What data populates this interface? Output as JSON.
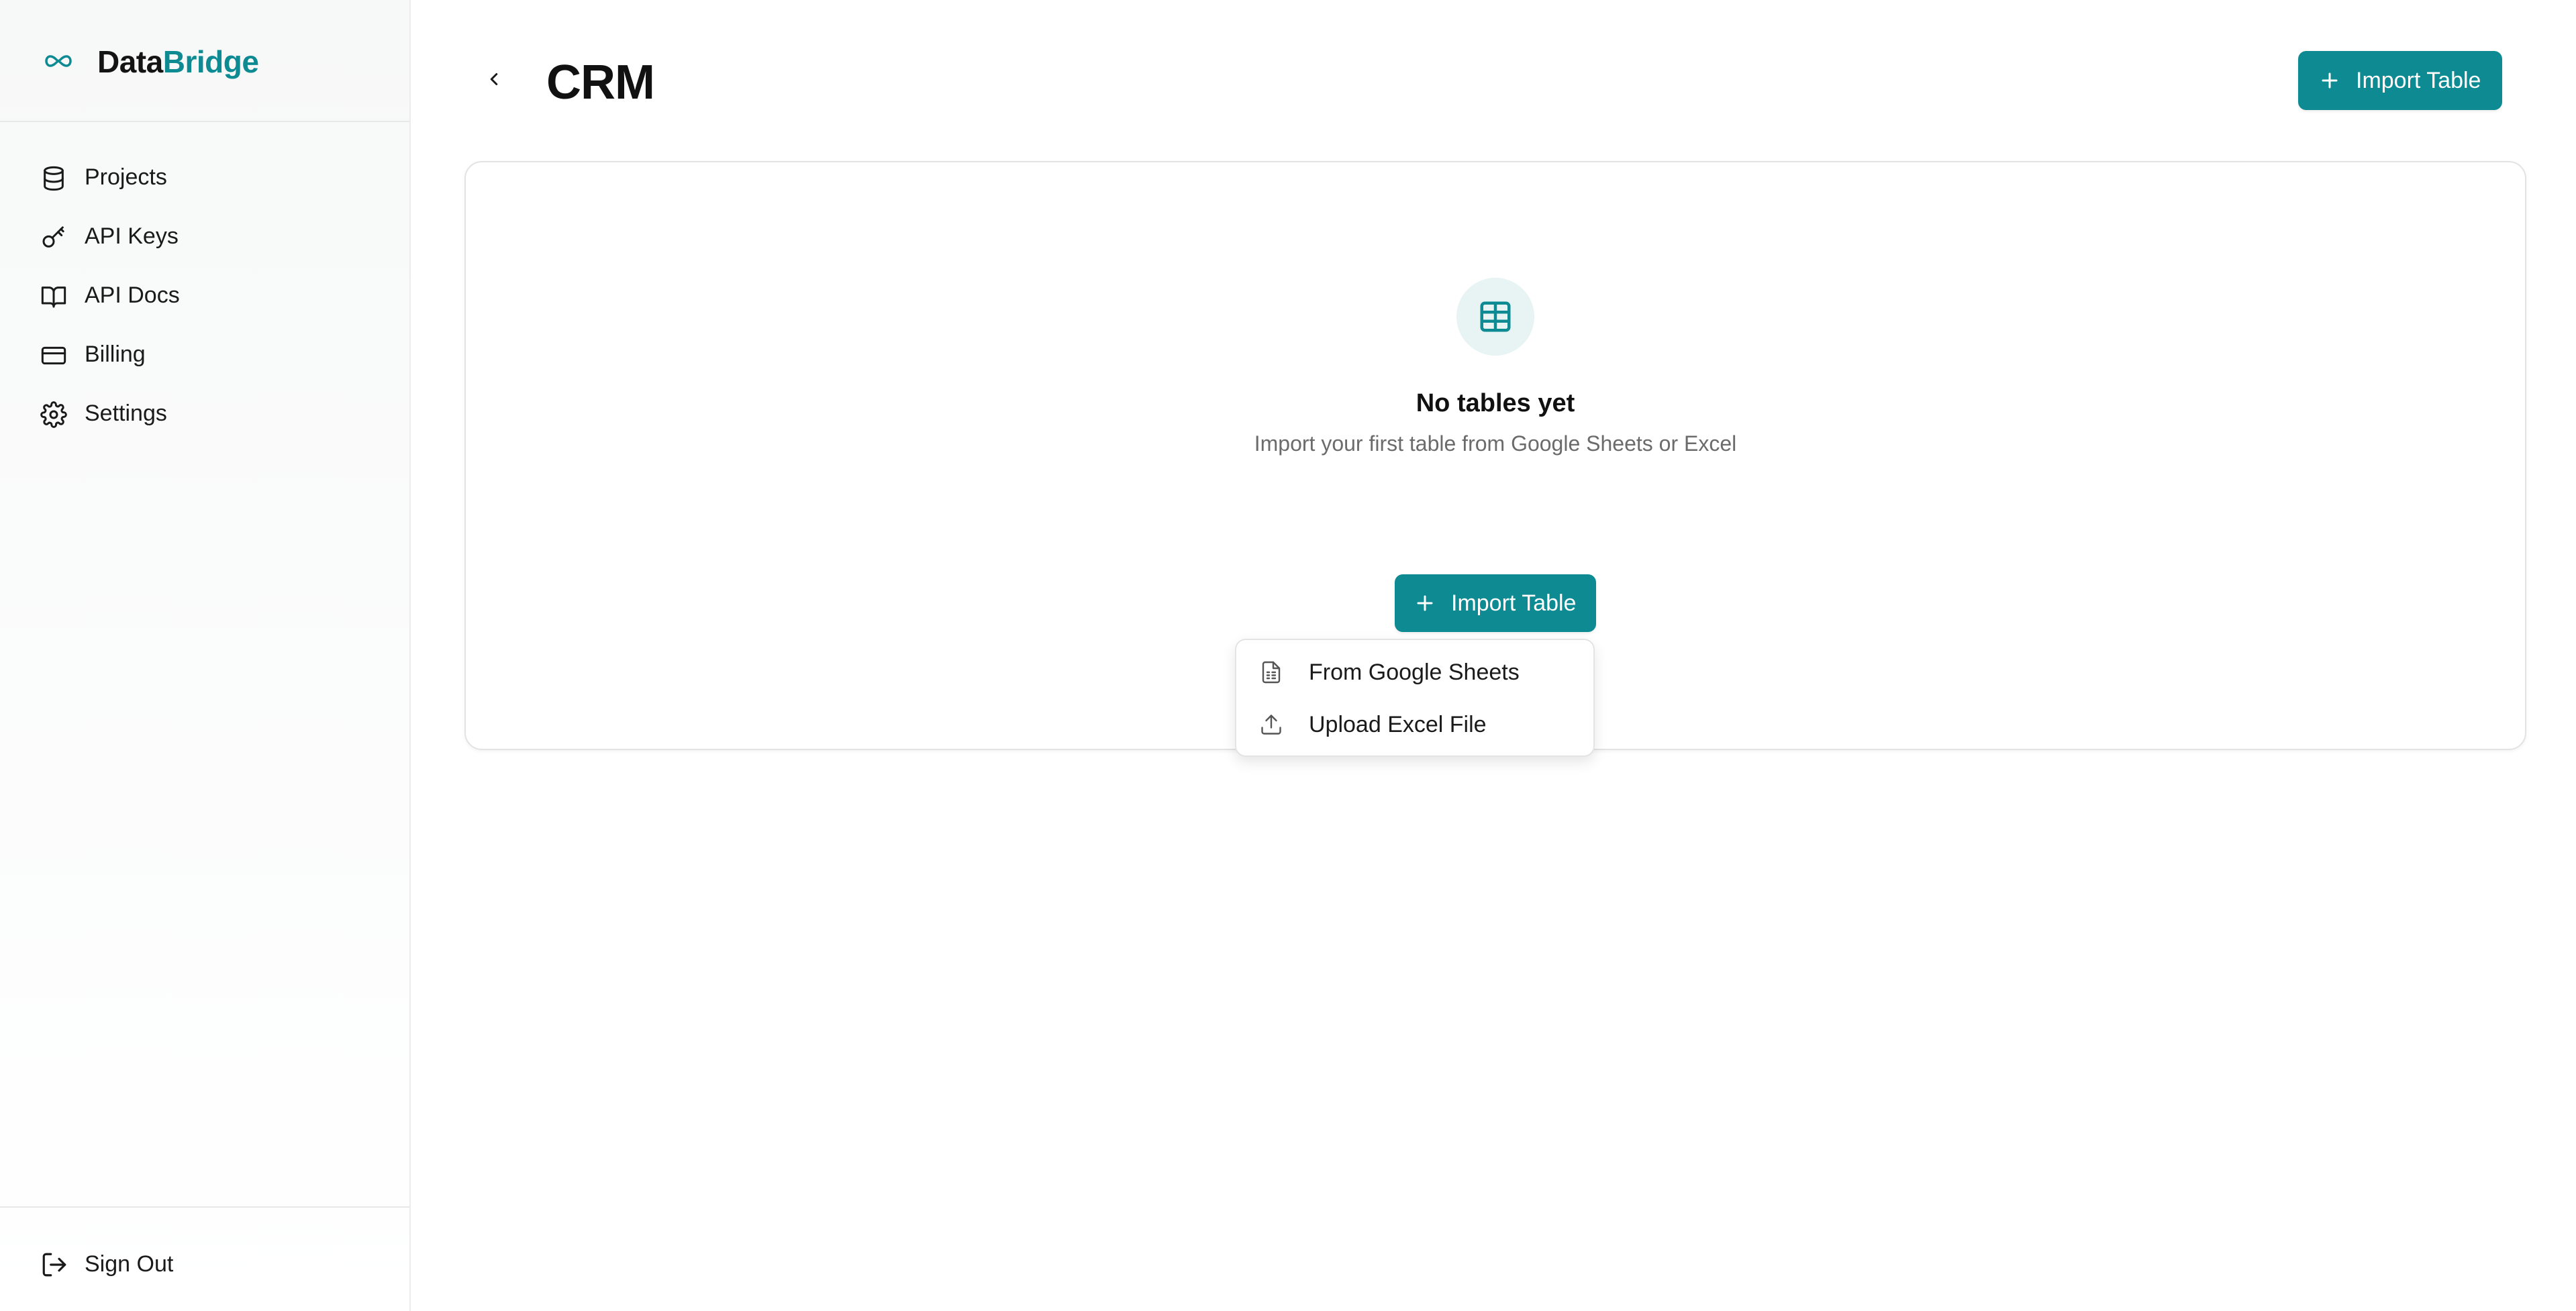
{
  "brand": {
    "name_part1": "Data",
    "name_part2": "Bridge",
    "icon": "infinity-icon",
    "accent": "#0d8a92"
  },
  "sidebar": {
    "items": [
      {
        "label": "Projects",
        "icon": "database-icon"
      },
      {
        "label": "API Keys",
        "icon": "key-icon"
      },
      {
        "label": "API Docs",
        "icon": "book-icon"
      },
      {
        "label": "Billing",
        "icon": "credit-card-icon"
      },
      {
        "label": "Settings",
        "icon": "gear-icon"
      }
    ],
    "sign_out": {
      "label": "Sign Out",
      "icon": "sign-out-icon"
    }
  },
  "header": {
    "back_icon": "chevron-left-icon",
    "title": "CRM",
    "import_button": {
      "label": "Import Table",
      "icon": "plus-icon"
    }
  },
  "empty_state": {
    "icon": "table-icon",
    "title": "No tables yet",
    "subtitle": "Import your first table from Google Sheets or Excel",
    "import_button": {
      "label": "Import Table",
      "icon": "plus-icon"
    }
  },
  "import_menu": {
    "items": [
      {
        "label": "From Google Sheets",
        "icon": "spreadsheet-file-icon"
      },
      {
        "label": "Upload Excel File",
        "icon": "upload-icon"
      }
    ]
  },
  "colors": {
    "primary": "#0d8a92",
    "icon_bg": "#e8f4f4",
    "muted_text": "#6b6b6b"
  }
}
